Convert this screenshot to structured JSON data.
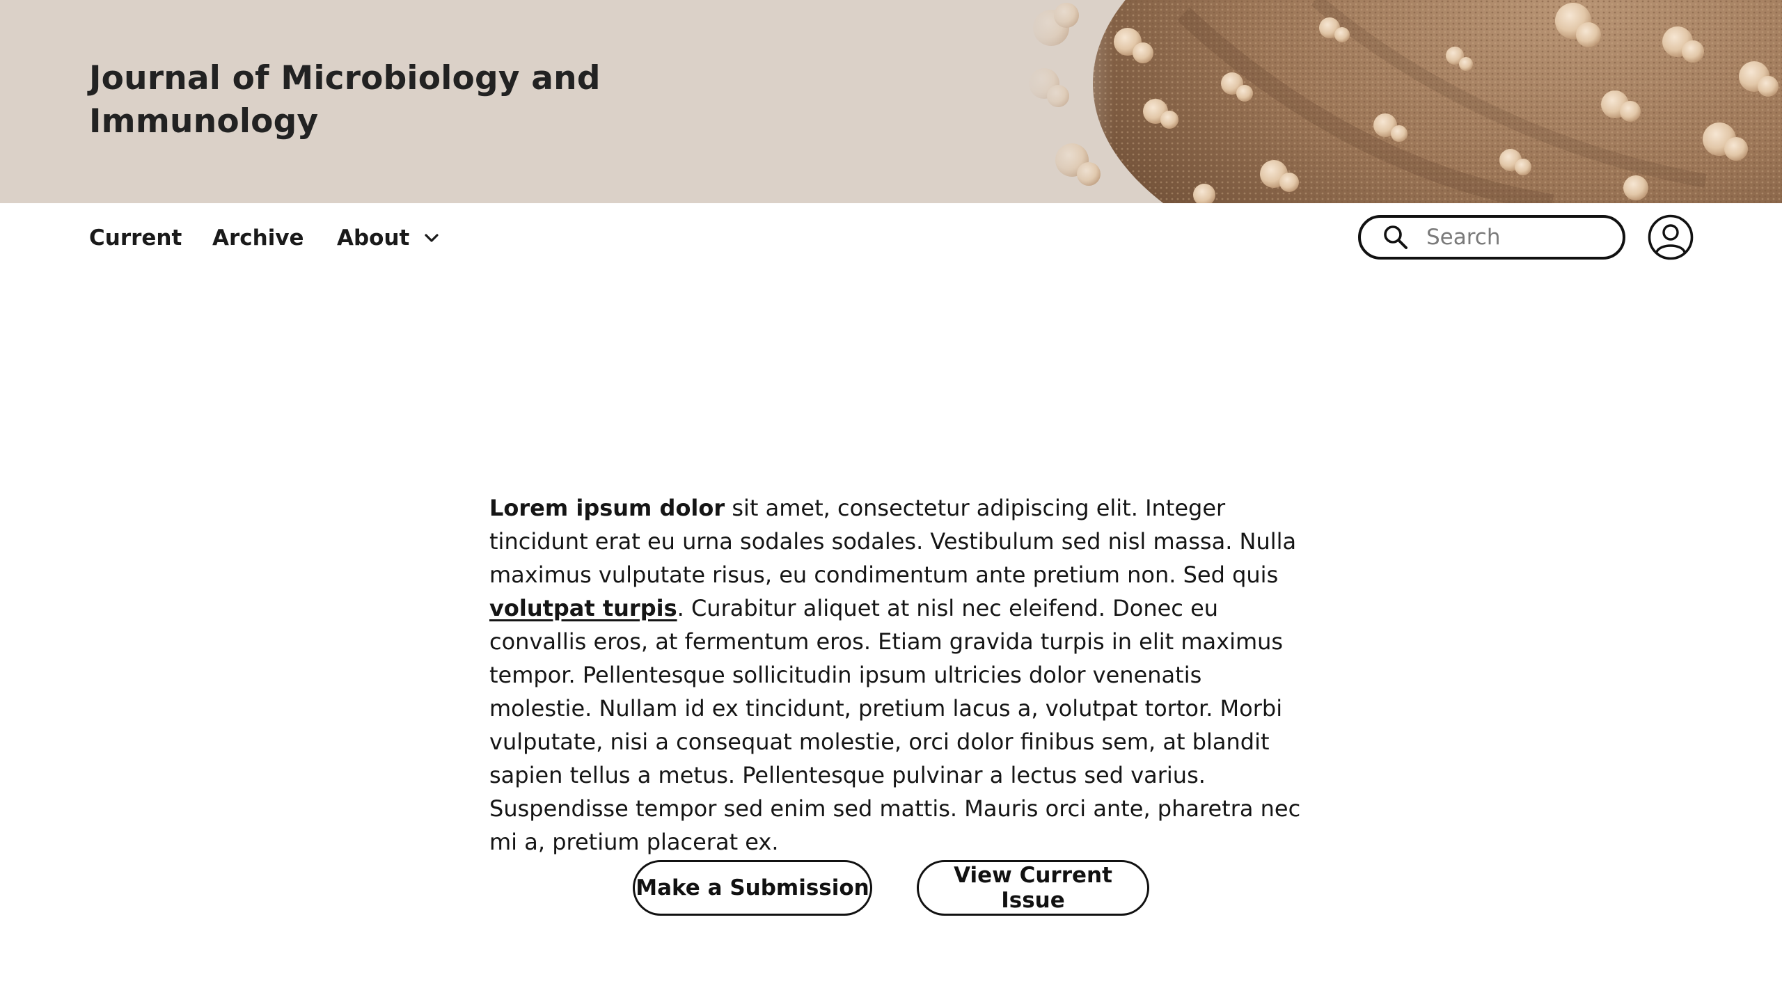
{
  "header": {
    "title": "Journal of Microbiology and Immunology",
    "banner_image": "virus-particle-illustration",
    "background_color": "#dbd1c8"
  },
  "nav": {
    "items": [
      {
        "label": "Current"
      },
      {
        "label": "Archive"
      },
      {
        "label": "About",
        "icon": "chevron-down-icon"
      }
    ],
    "search": {
      "placeholder": "Search",
      "icon": "search-icon"
    },
    "account_icon": "user-account-icon"
  },
  "main": {
    "intro": {
      "bold_lead": "Lorem ipsum dolor",
      "text_1": " sit amet, consectetur adipiscing elit. Integer  tincidunt erat eu urna sodales sodales. Vestibulum sed nisl massa. Nulla  maximus vulputate risus, eu condimentum ante pretium non. Sed quis  ",
      "link": "volutpat turpis",
      "text_2": ". Curabitur aliquet at nisl nec eleifend. Donec eu  convallis eros, at fermentum eros. Etiam gravida turpis in elit maximus  tempor. Pellentesque sollicitudin ipsum ultricies dolor venenatis molestie. Nullam id ex tincidunt, pretium lacus a, volutpat tortor.  Morbi vulputate, nisi a consequat molestie, orci dolor finibus sem, at  blandit sapien tellus a metus. Pellentesque pulvinar a lectus sed  varius. Suspendisse tempor sed enim sed mattis. Mauris orci ante,  pharetra nec mi a, pretium placerat ex."
    },
    "buttons": {
      "submission": "Make a Submission",
      "current_issue": "View Current Issue"
    }
  }
}
